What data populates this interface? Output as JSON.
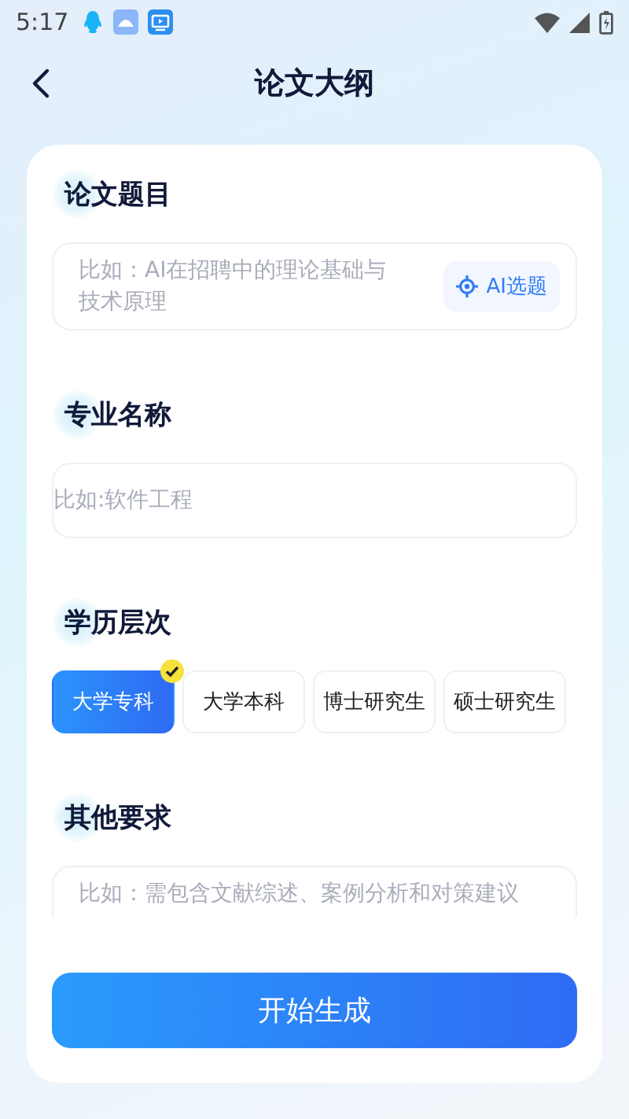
{
  "status_bar": {
    "time": "5:17"
  },
  "header": {
    "title": "论文大纲"
  },
  "sections": [
    {
      "kind": "textarea",
      "title": "论文题目",
      "placeholder": "比如：AI在招聘中的理论基础与技术原理",
      "action": "AI选题"
    },
    {
      "kind": "input",
      "title": "专业名称",
      "placeholder": "比如:软件工程"
    },
    {
      "kind": "chips",
      "title": "学历层次",
      "options": [
        {
          "label": "大学专科",
          "selected": true
        },
        {
          "label": "大学本科",
          "selected": false
        },
        {
          "label": "博士研究生",
          "selected": false
        },
        {
          "label": "硕士研究生",
          "selected": false
        }
      ]
    },
    {
      "kind": "textarea",
      "title": "其他要求",
      "placeholder": "比如：需包含文献综述、案例分析和对策建议"
    }
  ],
  "submit": "开始生成"
}
